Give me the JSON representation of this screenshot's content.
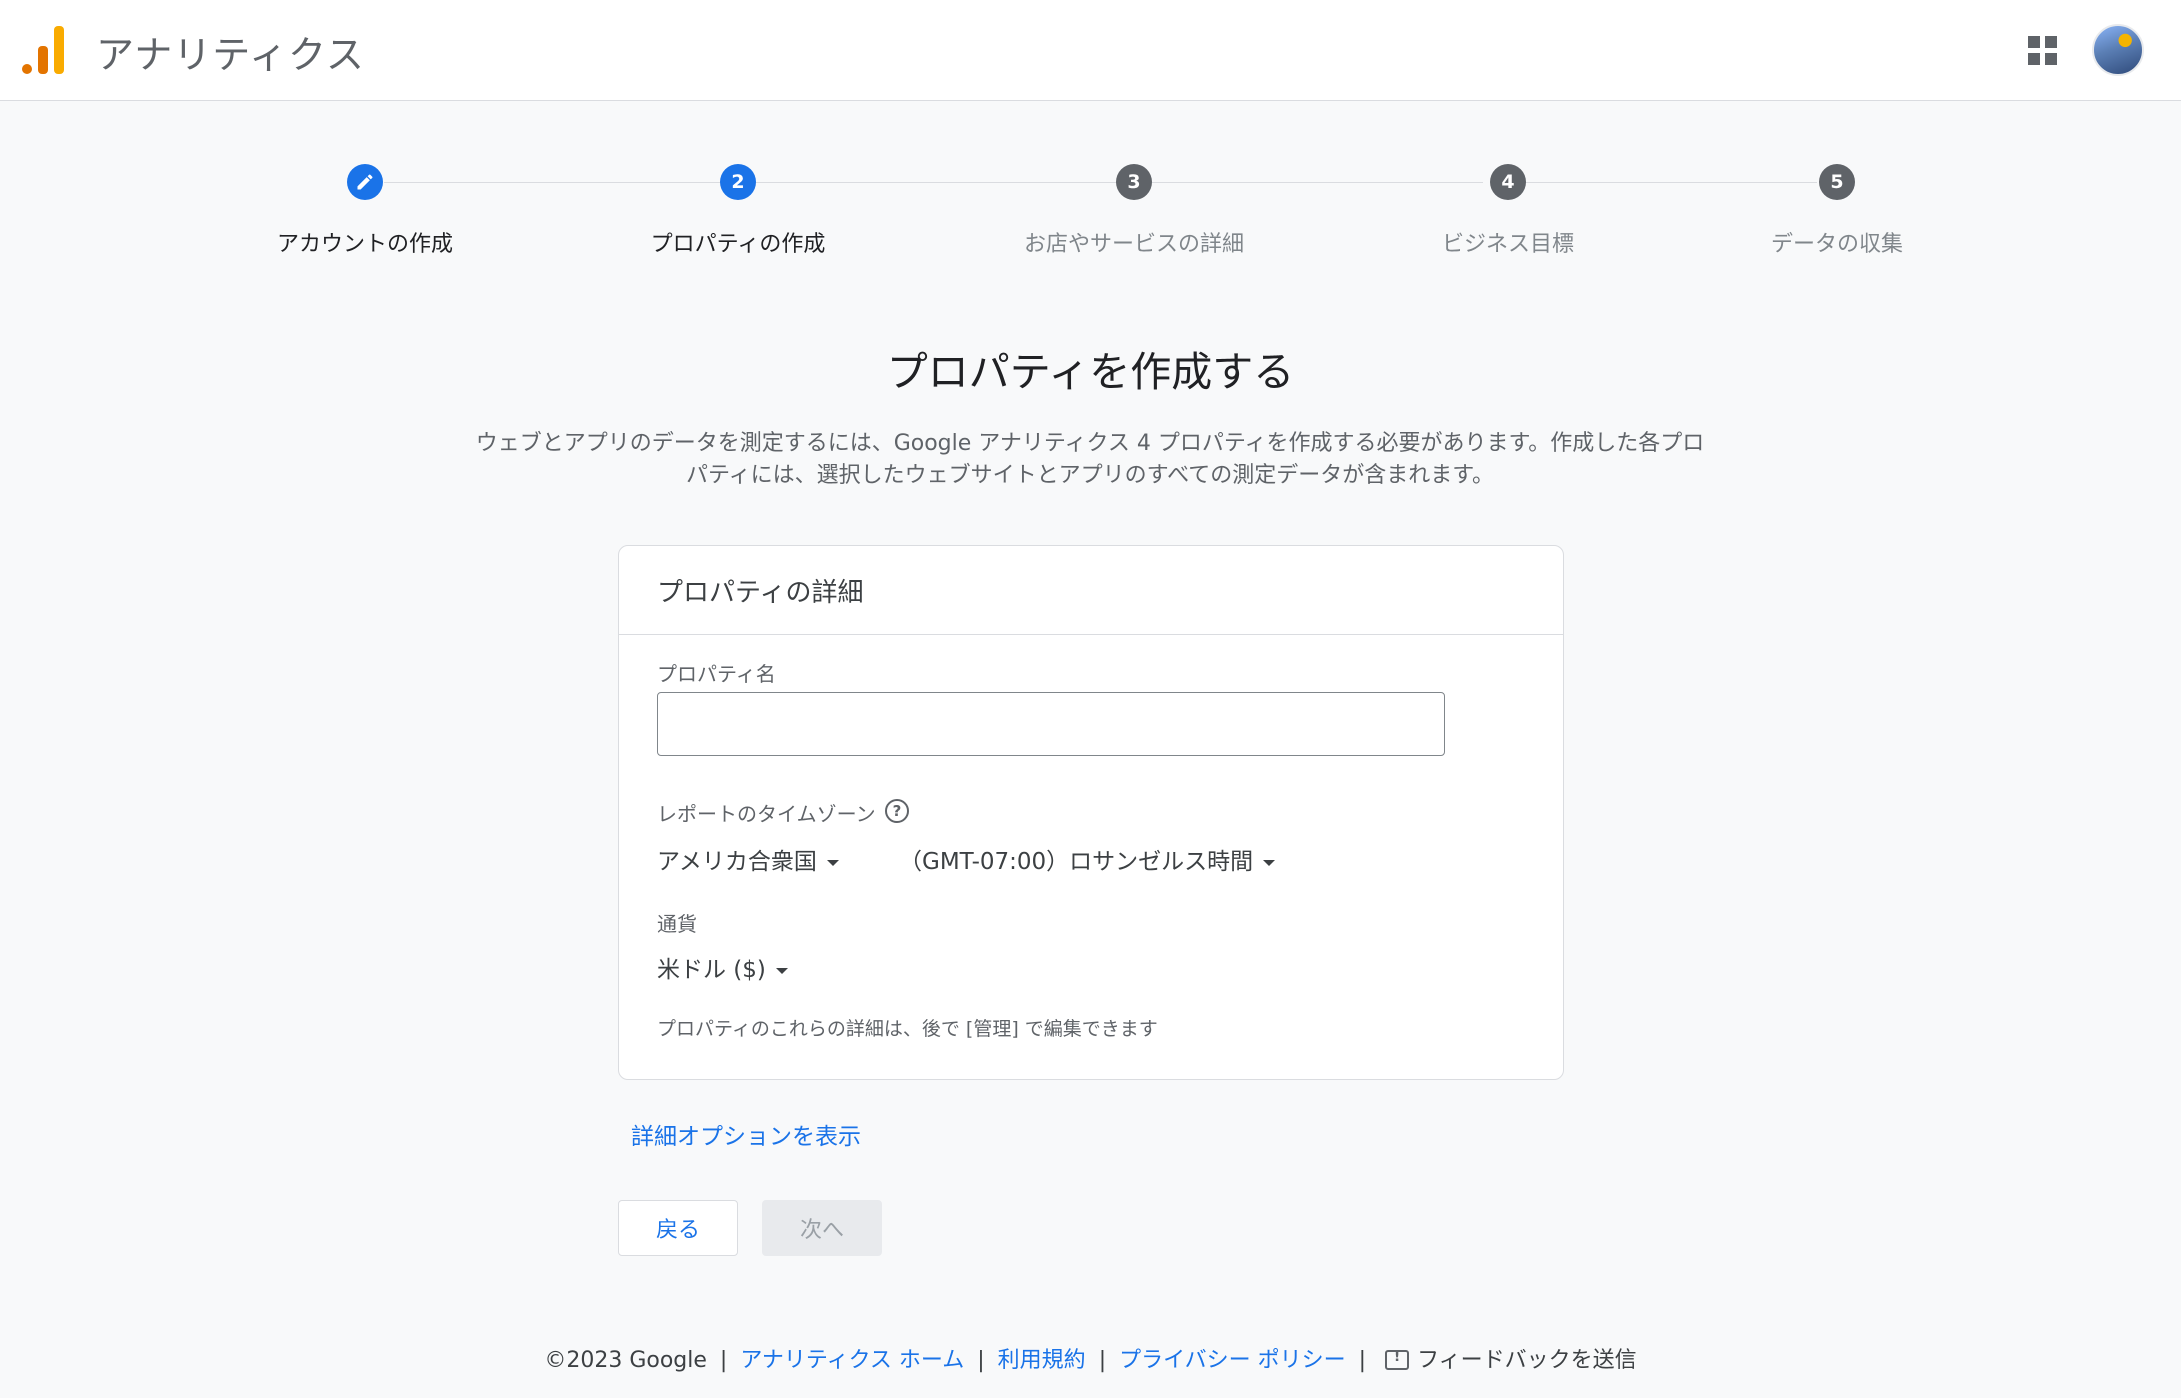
{
  "header": {
    "app_title": "アナリティクス",
    "apps_icon": "apps-grid-icon",
    "avatar_icon": "user-avatar"
  },
  "stepper": {
    "steps": [
      {
        "number": "",
        "label": "アカウントの作成",
        "state": "completed",
        "icon": "pencil-icon"
      },
      {
        "number": "2",
        "label": "プロパティの作成",
        "state": "active"
      },
      {
        "number": "3",
        "label": "お店やサービスの詳細",
        "state": "upcoming"
      },
      {
        "number": "4",
        "label": "ビジネス目標",
        "state": "upcoming"
      },
      {
        "number": "5",
        "label": "データの収集",
        "state": "upcoming"
      }
    ]
  },
  "main": {
    "title": "プロパティを作成する",
    "intro_line1": "ウェブとアプリのデータを測定するには、Google アナリティクス 4 プロパティを作成する必要があります。作成した各プロ",
    "intro_line2": "パティには、選択したウェブサイトとアプリのすべての測定データが含まれます。"
  },
  "card": {
    "header": "プロパティの詳細",
    "property_name_label": "プロパティ名",
    "property_name_value": "",
    "timezone_label": "レポートのタイムゾーン",
    "help_icon_glyph": "?",
    "country_value": "アメリカ合衆国",
    "timezone_value": "（GMT-07:00）ロサンゼルス時間",
    "currency_label": "通貨",
    "currency_value": "米ドル ($)",
    "note": "プロパティのこれらの詳細は、後で [管理] で編集できます"
  },
  "advanced_link": "詳細オプションを表示",
  "buttons": {
    "back": "戻る",
    "next": "次へ"
  },
  "footer": {
    "copyright": "©2023 Google",
    "separator": "|",
    "links": [
      "アナリティクス ホーム",
      "利用規約",
      "プライバシー ポリシー"
    ],
    "feedback": "フィードバックを送信",
    "feedback_icon": "feedback-icon"
  },
  "colors": {
    "accent": "#1a73e8",
    "step_inactive": "#5f6368",
    "background": "#f8f9fa",
    "logo_orange": "#e37400",
    "logo_yellow": "#f9ab00"
  }
}
